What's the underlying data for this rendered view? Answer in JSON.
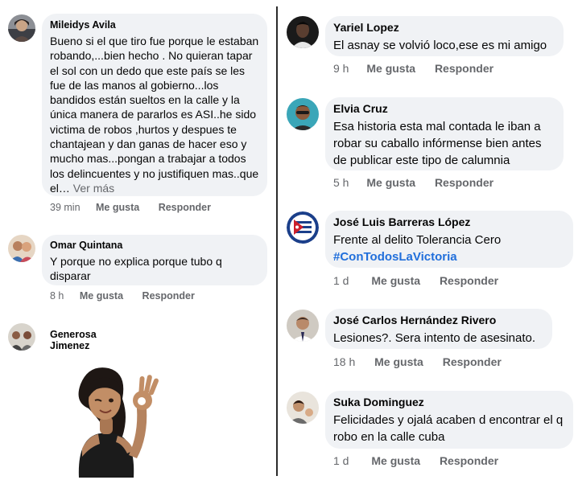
{
  "left_column": [
    {
      "author": "Mileidys Avila",
      "text": "Bueno si el que tiro fue porque le estaban robando,...bien hecho  . No quieran tapar el sol con un dedo que este país se les fue de las manos al gobierno...los bandidos están sueltos en la calle y la única manera de pararlos es ASI..he sido victima de robos ,hurtos y despues te chantajean y dan ganas de hacer eso y mucho mas...pongan a trabajar a todos los delincuentes y no justifiquen mas..que el…",
      "see_more": "Ver más",
      "time": "39 min",
      "like_label": "Me gusta",
      "reply_label": "Responder",
      "avatar_icon": "user-photo-avatar"
    },
    {
      "author": "Omar Quintana",
      "text": "Y porque no explica porque tubo q disparar",
      "time": "8 h",
      "like_label": "Me gusta",
      "reply_label": "Responder",
      "avatar_icon": "user-photo-avatar"
    },
    {
      "author": "Generosa Jimenez",
      "sticker": "avatar-sticker-ok-gesture",
      "avatar_icon": "user-photo-avatar"
    }
  ],
  "right_column": [
    {
      "author": "Yariel Lopez",
      "text": "El asnay se volvió loco,ese es mi amigo",
      "time": "9 h",
      "like_label": "Me gusta",
      "reply_label": "Responder",
      "avatar_icon": "user-photo-avatar"
    },
    {
      "author": "Elvia Cruz",
      "text": "Esa historia esta mal contada le iban a robar su caballo  infórmense bien antes de publicar este tipo de calumnia",
      "time": "5 h",
      "like_label": "Me gusta",
      "reply_label": "Responder",
      "avatar_icon": "user-photo-avatar"
    },
    {
      "author": "José Luis Barreras López",
      "text": "Frente al delito Tolerancia Cero",
      "hashtag": "#ConTodosLaVictoria",
      "time": "1 d",
      "like_label": "Me gusta",
      "reply_label": "Responder",
      "avatar_icon": "flag-badge-avatar"
    },
    {
      "author": "José Carlos Hernández Rivero",
      "text": "Lesiones?. Sera intento de asesinato.",
      "time": "18 h",
      "like_label": "Me gusta",
      "reply_label": "Responder",
      "avatar_icon": "user-photo-avatar"
    },
    {
      "author": "Suka Dominguez",
      "text": "Felicidades y ojalá acaben d encontrar el q robo en la calle cuba",
      "time": "1 d",
      "like_label": "Me gusta",
      "reply_label": "Responder",
      "avatar_icon": "user-photo-avatar"
    }
  ],
  "colors": {
    "bubble": "#f0f2f5",
    "meta_text": "#65676b",
    "hashtag": "#216fdb",
    "divider": "#2b2b2b"
  }
}
